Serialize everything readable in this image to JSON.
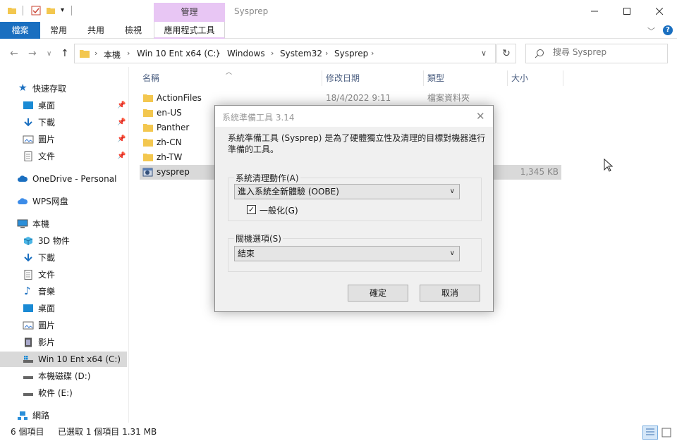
{
  "window": {
    "title": "Sysprep",
    "context_tab": "管理"
  },
  "ribbon": {
    "tabs": [
      "檔案",
      "常用",
      "共用",
      "檢視",
      "應用程式工具"
    ]
  },
  "address": {
    "crumbs": [
      "本機",
      "Win 10 Ent x64 (C:)",
      "Windows",
      "System32",
      "Sysprep"
    ],
    "search_placeholder": "搜尋 Sysprep"
  },
  "nav": {
    "quick_access": "快速存取",
    "quick_items": [
      "桌面",
      "下載",
      "圖片",
      "文件"
    ],
    "onedrive": "OneDrive - Personal",
    "wps": "WPS网盘",
    "this_pc": "本機",
    "pc_items": [
      "3D 物件",
      "下載",
      "文件",
      "音樂",
      "桌面",
      "圖片",
      "影片",
      "Win 10 Ent x64 (C:)",
      "本機磁碟 (D:)",
      "軟件 (E:)"
    ],
    "network": "網路"
  },
  "columns": {
    "name": "名稱",
    "date": "修改日期",
    "type": "類型",
    "size": "大小"
  },
  "files": [
    {
      "name": "ActionFiles",
      "date": "18/4/2022 9:11",
      "type": "檔案資料夾",
      "size": ""
    },
    {
      "name": "en-US",
      "date": "",
      "type": "",
      "size": ""
    },
    {
      "name": "Panther",
      "date": "",
      "type": "",
      "size": ""
    },
    {
      "name": "zh-CN",
      "date": "",
      "type": "",
      "size": ""
    },
    {
      "name": "zh-TW",
      "date": "",
      "type": "",
      "size": ""
    },
    {
      "name": "sysprep",
      "date": "",
      "type": "",
      "size": "1,345 KB"
    }
  ],
  "status": {
    "count": "6 個項目",
    "selected": "已選取 1 個項目  1.31 MB"
  },
  "dialog": {
    "title": "系統準備工具 3.14",
    "description": "系統準備工具 (Sysprep) 是為了硬體獨立性及清理的目標對機器進行準備的工具。",
    "cleanup_label": "系統清理動作(A)",
    "cleanup_value": "進入系統全新體驗 (OOBE)",
    "generalize_label": "一般化(G)",
    "generalize_checked": true,
    "shutdown_label": "關機選項(S)",
    "shutdown_value": "結束",
    "ok": "確定",
    "cancel": "取消"
  }
}
